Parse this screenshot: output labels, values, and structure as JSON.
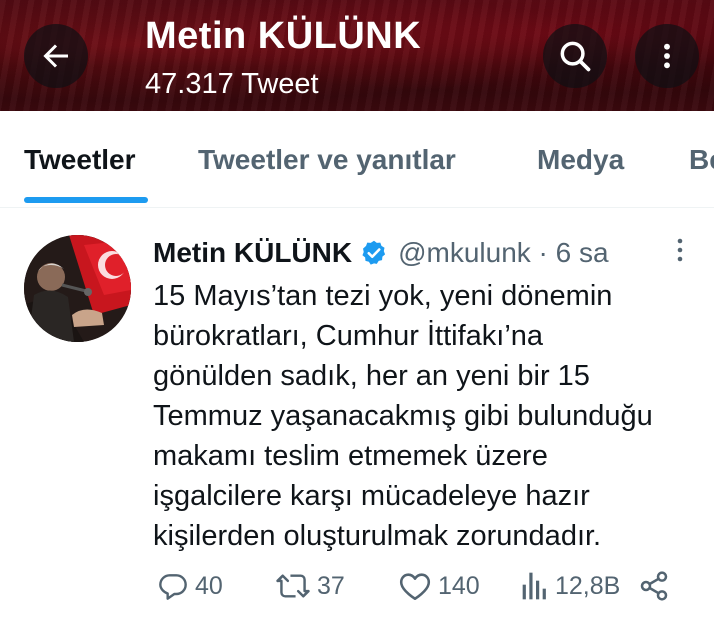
{
  "header": {
    "title": "Metin KÜLÜNK",
    "tweet_count": "47.317 Tweet",
    "back_icon": "arrow-left-icon",
    "search_icon": "search-icon",
    "more_icon": "more-vertical-icon"
  },
  "tabs": [
    {
      "label": "Tweetler",
      "active": true
    },
    {
      "label": "Tweetler ve yanıtlar",
      "active": false
    },
    {
      "label": "Medya",
      "active": false
    },
    {
      "label": "Be",
      "active": false
    }
  ],
  "tweet": {
    "author_name": "Metin KÜLÜNK",
    "handle_time": "@mkulunk · 6 sa",
    "lines": [
      "15 Mayıs’tan tezi yok, yeni dönemin",
      "bürokratları, Cumhur İttifakı’na",
      "gönülden sadık, her an yeni bir 15",
      "Temmuz yaşanacakmış gibi bulunduğu",
      "makamı teslim etmemek üzere",
      "işgalcilere karşı mücadeleye hazır",
      "kişilerden oluşturulmak zorundadır."
    ],
    "actions": {
      "replies": "40",
      "retweets": "37",
      "likes": "140",
      "views": "12,8B"
    }
  },
  "colors": {
    "accent": "#1d9bf0",
    "text": "#0f1419",
    "secondary": "#536471"
  }
}
